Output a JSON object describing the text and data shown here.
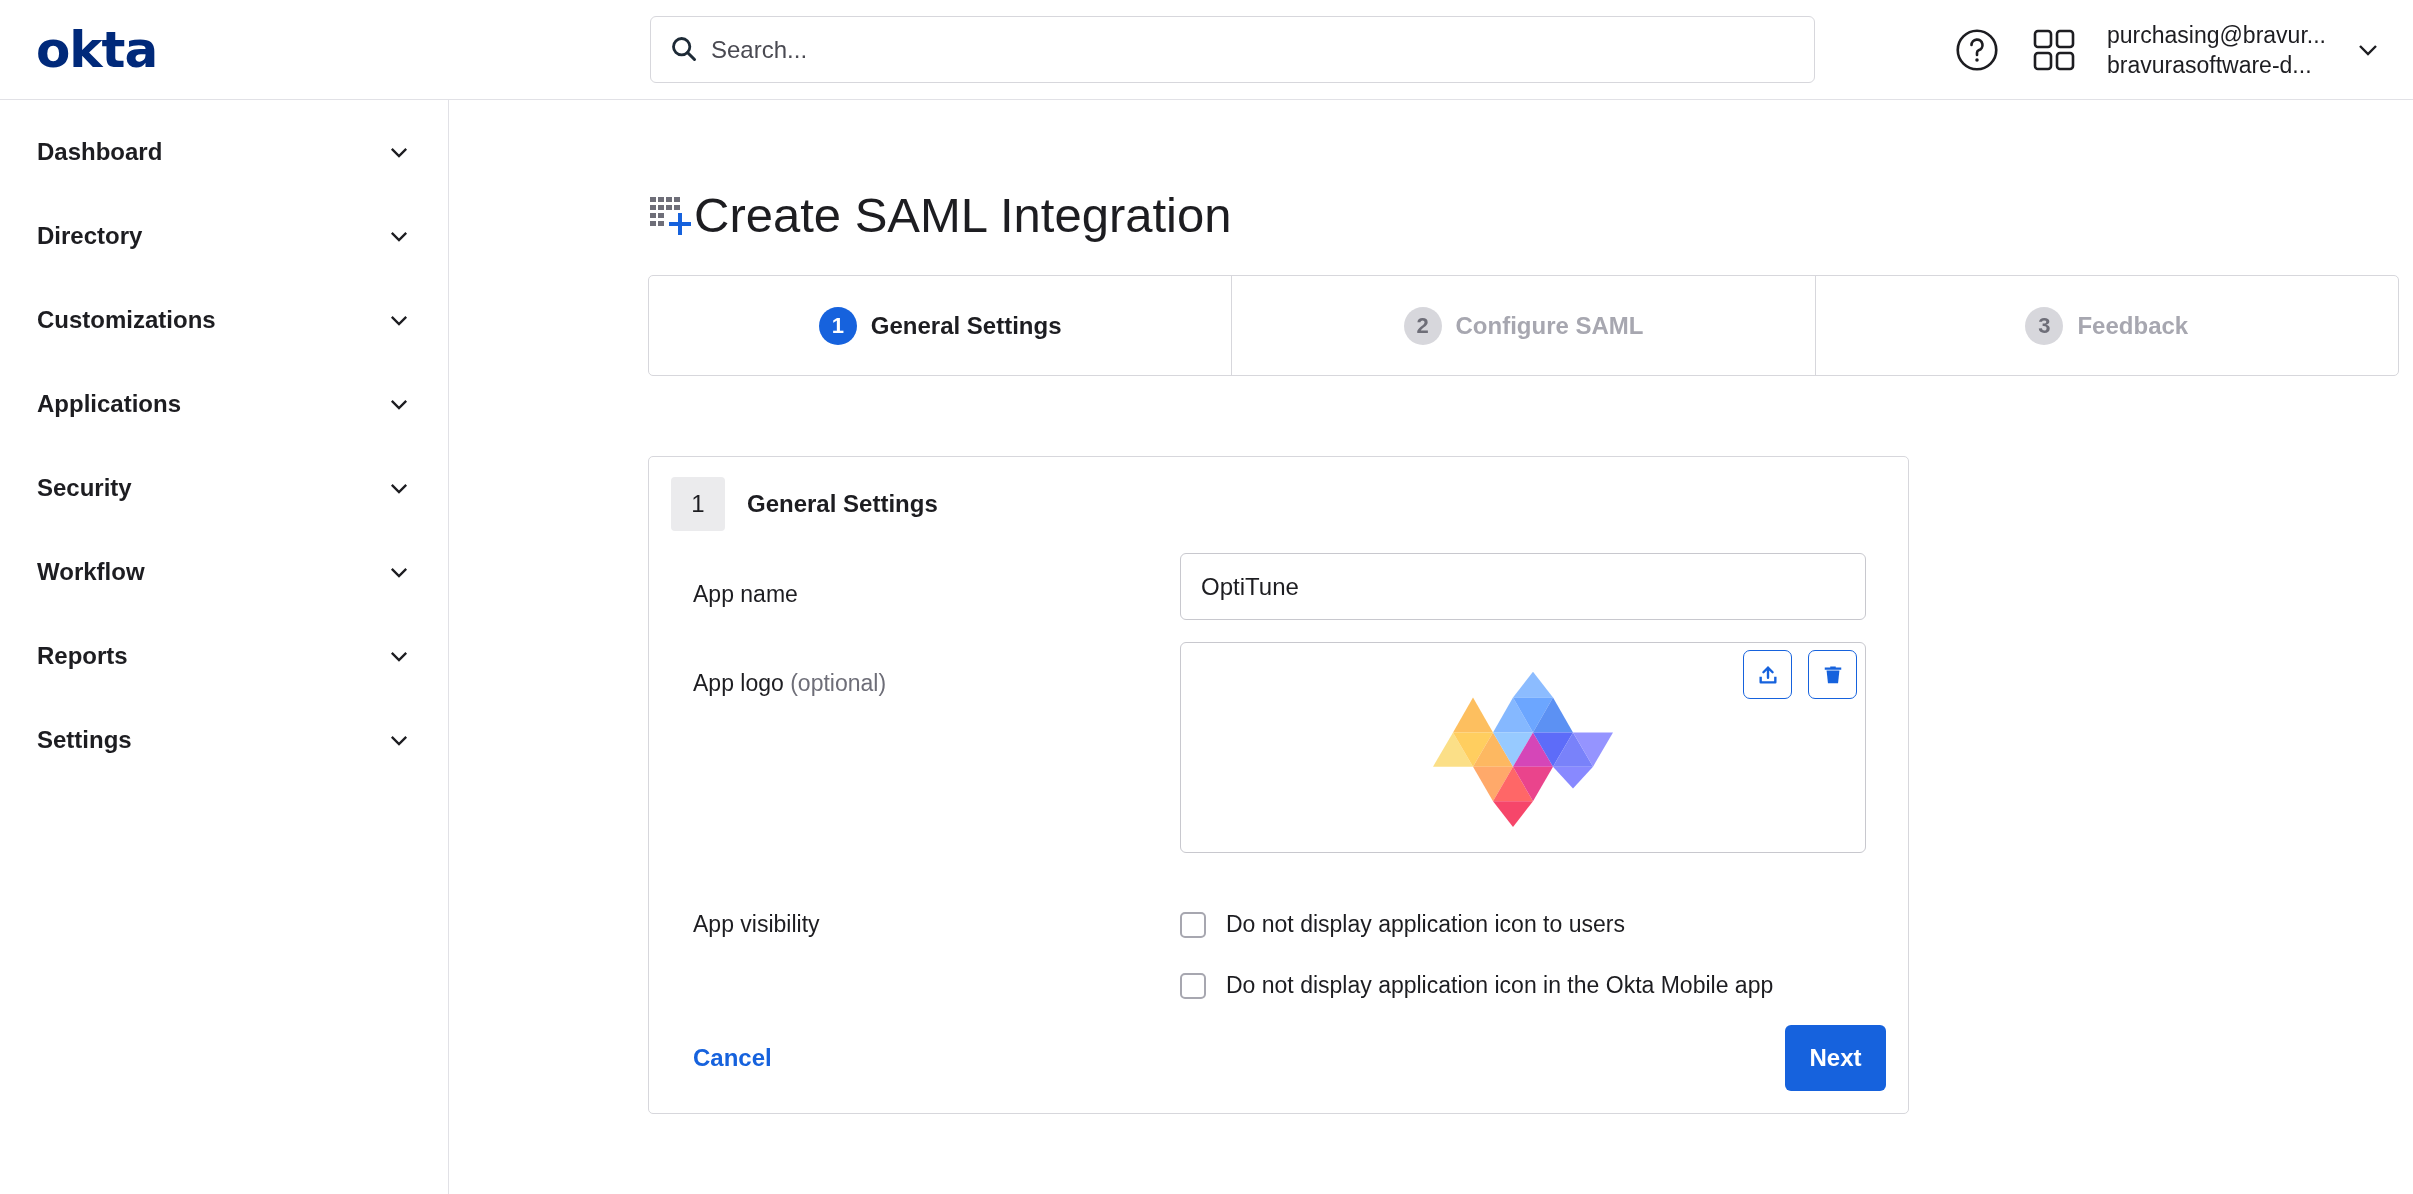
{
  "header": {
    "logo": "okta",
    "search": {
      "placeholder": "Search..."
    },
    "user": {
      "email": "purchasing@bravur...",
      "org": "bravurasoftware-d..."
    }
  },
  "sidebar": {
    "items": [
      {
        "label": "Dashboard",
        "expanded": false
      },
      {
        "label": "Directory",
        "expanded": false
      },
      {
        "label": "Customizations",
        "expanded": false
      },
      {
        "label": "Applications",
        "expanded": false
      },
      {
        "label": "Security",
        "expanded": false
      },
      {
        "label": "Workflow",
        "expanded": false
      },
      {
        "label": "Reports",
        "expanded": false
      },
      {
        "label": "Settings",
        "expanded": false
      }
    ]
  },
  "page": {
    "title": "Create SAML Integration",
    "steps": [
      {
        "number": "1",
        "label": "General Settings",
        "selected": true
      },
      {
        "number": "2",
        "label": "Configure SAML",
        "selected": false
      },
      {
        "number": "3",
        "label": "Feedback",
        "selected": false
      }
    ],
    "card": {
      "number": "1",
      "title": "General Settings",
      "app_name": {
        "label": "App name",
        "value": "OptiTune"
      },
      "app_logo": {
        "label": "App logo",
        "hint": "(optional)"
      },
      "app_visibility": {
        "label": "App visibility",
        "options": [
          {
            "label": "Do not display application icon to users",
            "checked": false
          },
          {
            "label": "Do not display application icon in the Okta Mobile app",
            "checked": false
          }
        ]
      },
      "cancel": "Cancel",
      "next": "Next"
    }
  }
}
